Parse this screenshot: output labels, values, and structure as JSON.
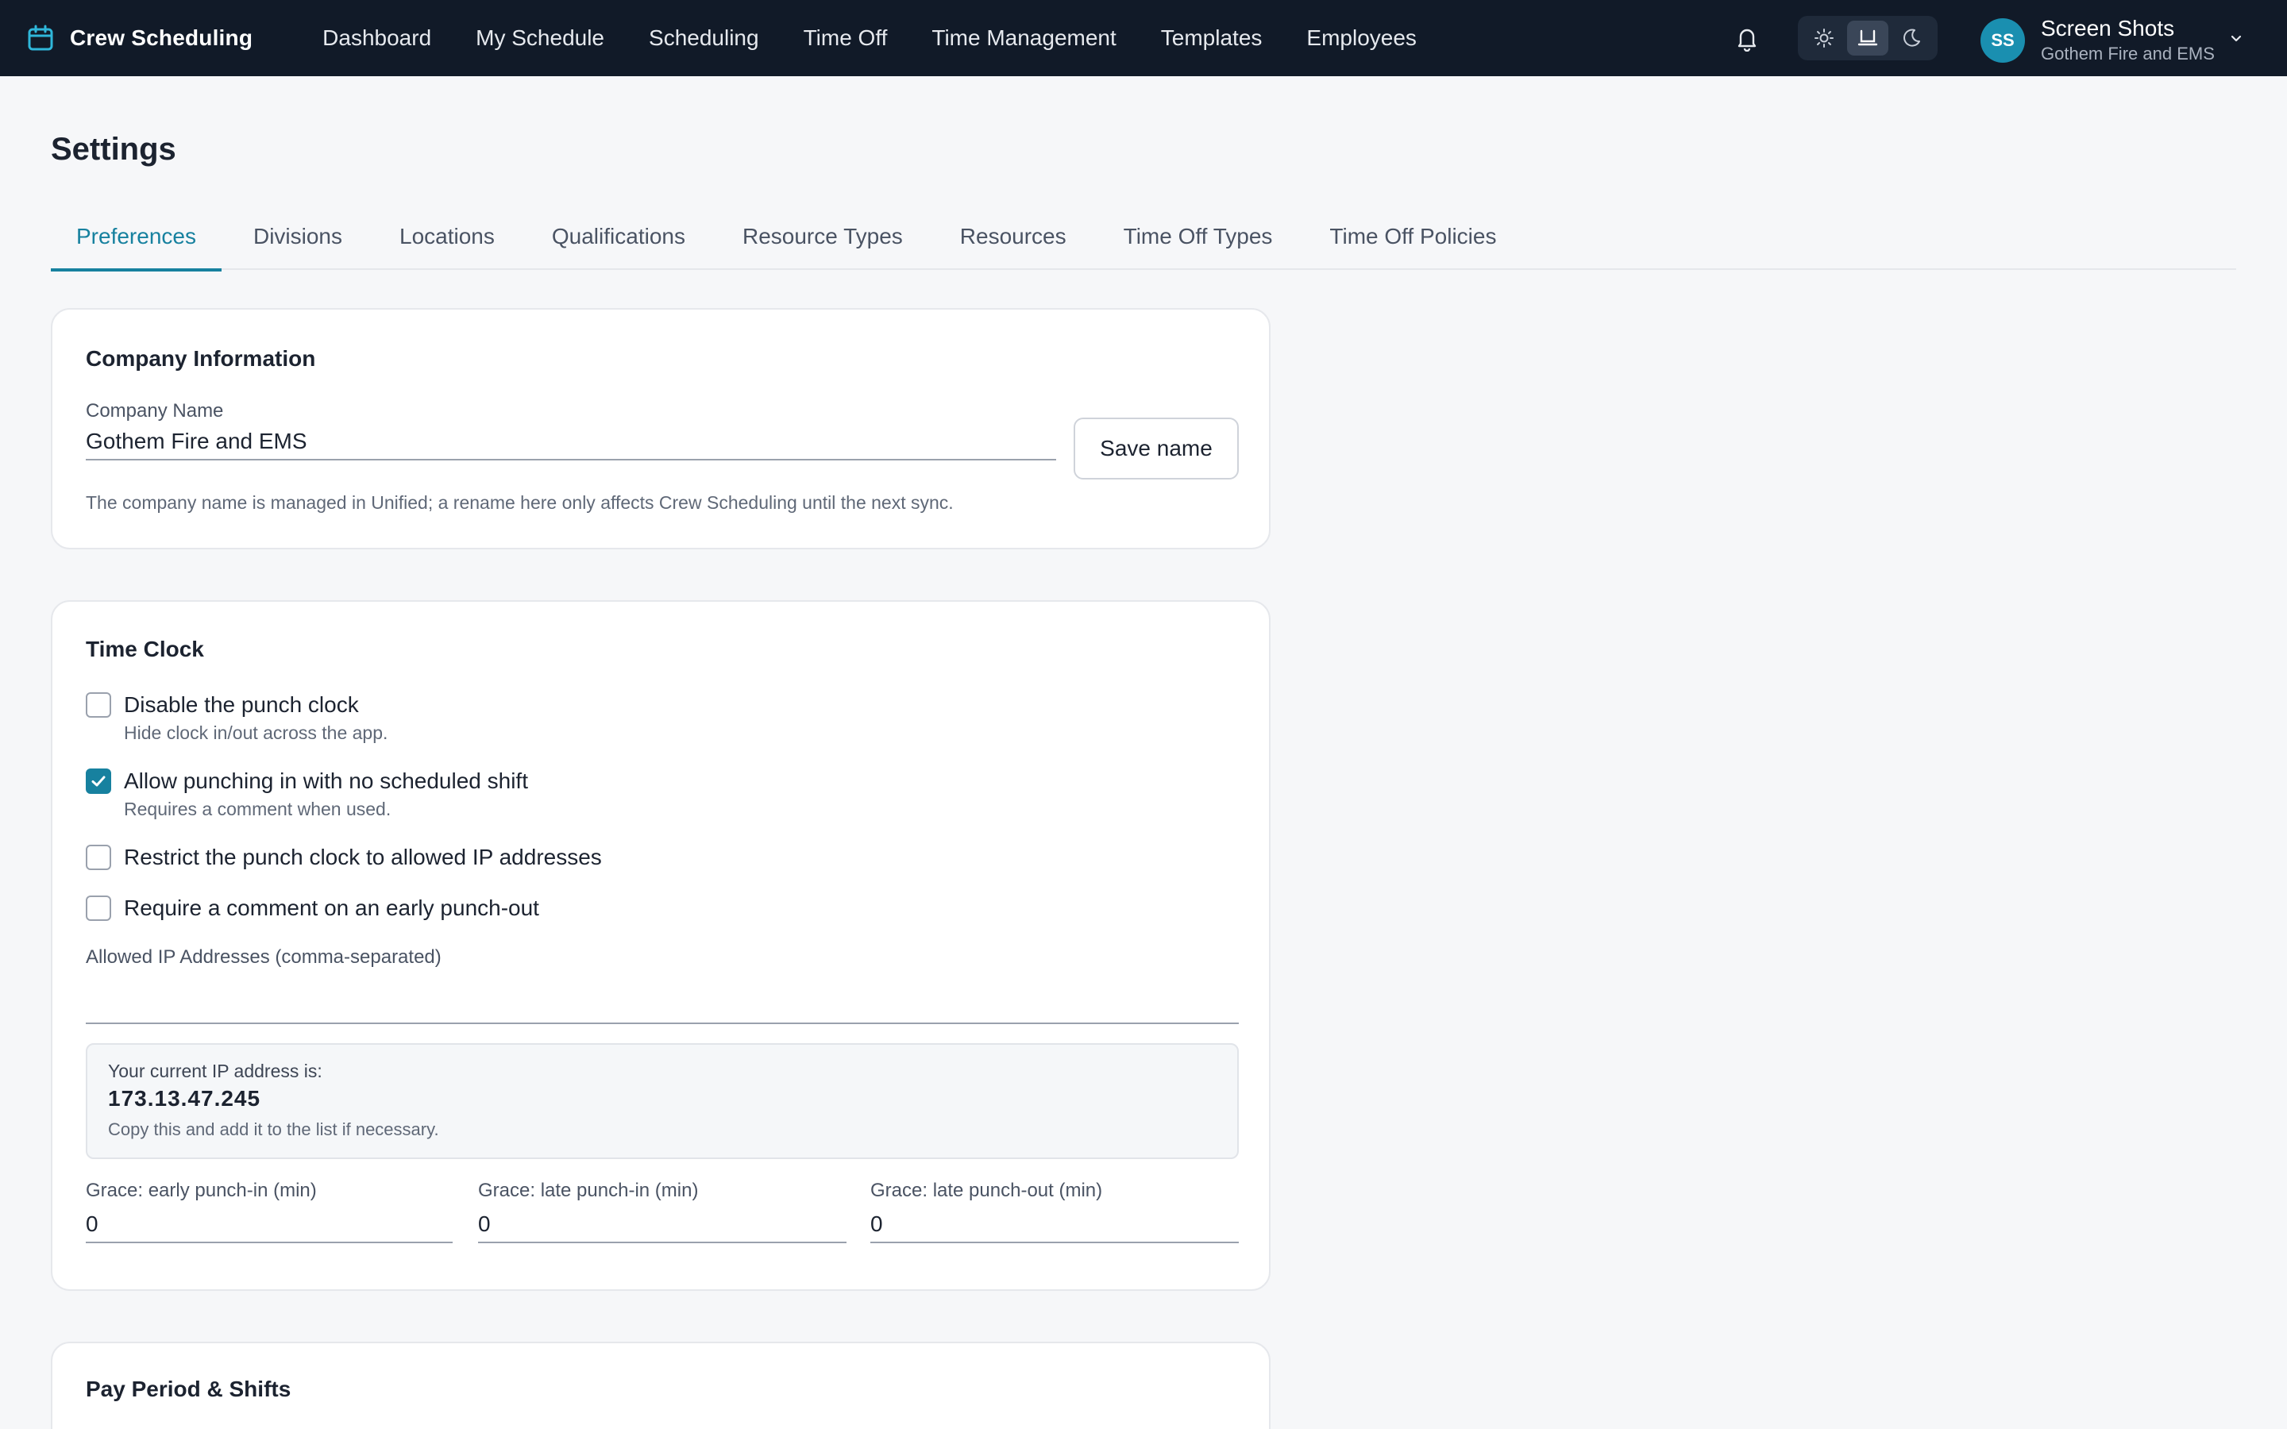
{
  "app": {
    "name": "Crew Scheduling",
    "accent_color": "#17819f",
    "topbar_color": "#111a28"
  },
  "nav": {
    "items": [
      "Dashboard",
      "My Schedule",
      "Scheduling",
      "Time Off",
      "Time Management",
      "Templates",
      "Employees"
    ]
  },
  "header": {
    "icons": [
      "bell-icon",
      "sun-icon",
      "monitor-icon",
      "moon-icon",
      "chevron-down-icon"
    ],
    "theme_active": "system"
  },
  "user": {
    "initials": "SS",
    "name": "Screen Shots",
    "org": "Gothem Fire and EMS"
  },
  "page": {
    "title": "Settings",
    "tabs": [
      "Preferences",
      "Divisions",
      "Locations",
      "Qualifications",
      "Resource Types",
      "Resources",
      "Time Off Types",
      "Time Off Policies"
    ],
    "active_tab": "Preferences"
  },
  "company": {
    "title": "Company Information",
    "name_label": "Company Name",
    "name_value": "Gothem Fire and EMS",
    "save_label": "Save name",
    "hint": "The company name is managed in Unified; a rename here only affects Crew Scheduling until the next sync."
  },
  "timeclock": {
    "title": "Time Clock",
    "options": [
      {
        "label": "Disable the punch clock",
        "desc": "Hide clock in/out across the app.",
        "checked": false
      },
      {
        "label": "Allow punching in with no scheduled shift",
        "desc": "Requires a comment when used.",
        "checked": true
      },
      {
        "label": "Restrict the punch clock to allowed IP addresses",
        "desc": "",
        "checked": false
      },
      {
        "label": "Require a comment on an early punch-out",
        "desc": "",
        "checked": false
      }
    ],
    "ip_label": "Allowed IP Addresses (comma-separated)",
    "ip_value": "",
    "current_ip_label": "Your current IP address is:",
    "current_ip": "173.13.47.245",
    "current_ip_note": "Copy this and add it to the list if necessary.",
    "grace": [
      {
        "label": "Grace: early punch-in (min)",
        "value": "0"
      },
      {
        "label": "Grace: late punch-in (min)",
        "value": "0"
      },
      {
        "label": "Grace: late punch-out (min)",
        "value": "0"
      }
    ]
  },
  "payperiod": {
    "title": "Pay Period & Shifts"
  }
}
